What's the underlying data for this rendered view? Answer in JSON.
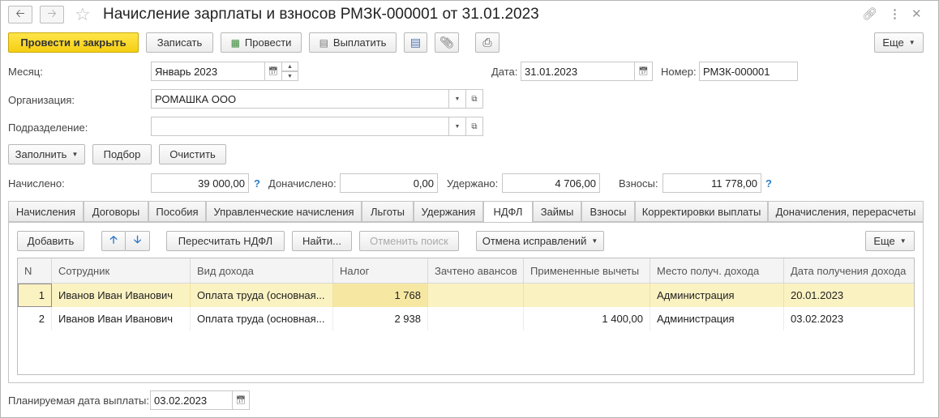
{
  "window": {
    "title": "Начисление зарплаты и взносов РМЗК-000001 от 31.01.2023"
  },
  "toolbar": {
    "post_close": "Провести и закрыть",
    "write": "Записать",
    "post": "Провести",
    "pay": "Выплатить",
    "more": "Еще"
  },
  "form": {
    "month_label": "Месяц:",
    "month_value": "Январь 2023",
    "date_label": "Дата:",
    "date_value": "31.01.2023",
    "number_label": "Номер:",
    "number_value": "РМЗК-000001",
    "org_label": "Организация:",
    "org_value": "РОМАШКА ООО",
    "dept_label": "Подразделение:",
    "dept_value": ""
  },
  "actions": {
    "fill": "Заполнить",
    "select": "Подбор",
    "clear": "Очистить"
  },
  "totals": {
    "accrued_label": "Начислено:",
    "accrued_value": "39 000,00",
    "extra_label": "Доначислено:",
    "extra_value": "0,00",
    "withheld_label": "Удержано:",
    "withheld_value": "4 706,00",
    "contrib_label": "Взносы:",
    "contrib_value": "11 778,00",
    "help": "?"
  },
  "tabs": [
    "Начисления",
    "Договоры",
    "Пособия",
    "Управленческие начисления",
    "Льготы",
    "Удержания",
    "НДФЛ",
    "Займы",
    "Взносы",
    "Корректировки выплаты",
    "Доначисления, перерасчеты"
  ],
  "panel": {
    "add": "Добавить",
    "recalc": "Пересчитать НДФЛ",
    "find": "Найти...",
    "cancel_search": "Отменить поиск",
    "cancel_fix": "Отмена исправлений",
    "more": "Еще"
  },
  "table": {
    "columns": [
      "N",
      "Сотрудник",
      "Вид дохода",
      "Налог",
      "Зачтено авансов",
      "Примененные вычеты",
      "Место получ. дохода",
      "Дата получения дохода"
    ],
    "rows": [
      [
        "1",
        "Иванов Иван Иванович",
        "Оплата труда (основная...",
        "1 768",
        "",
        "",
        "Администрация",
        "20.01.2023"
      ],
      [
        "2",
        "Иванов Иван Иванович",
        "Оплата труда (основная...",
        "2 938",
        "",
        "1 400,00",
        "Администрация",
        "03.02.2023"
      ]
    ]
  },
  "footer": {
    "pay_date_label": "Планируемая дата выплаты:",
    "pay_date_value": "03.02.2023"
  },
  "colors": {
    "primary_button": "#f5cf12",
    "selected_row": "#fbf2c2",
    "help_mark": "#2a7fc9"
  }
}
